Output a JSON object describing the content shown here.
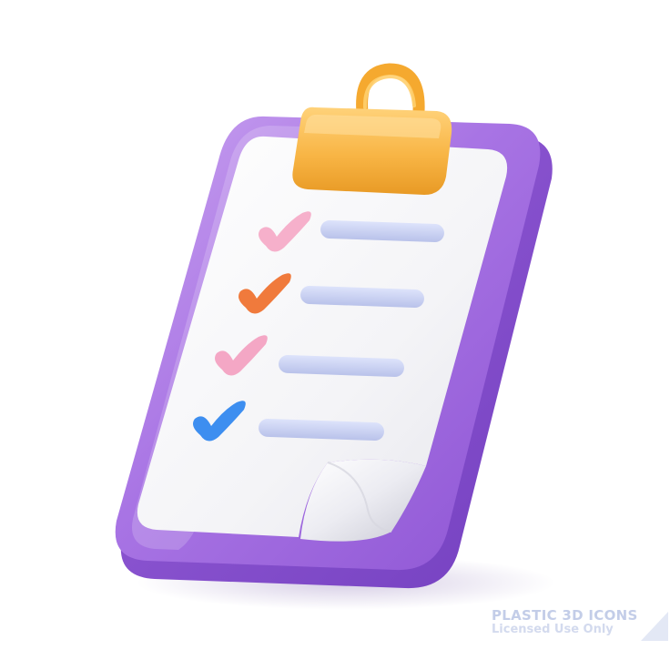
{
  "illustration": {
    "subject": "clipboard-checklist",
    "icon": "clipboard-checklist-icon",
    "checklist_items": [
      {
        "check_icon": "checkmark-icon",
        "check_color": "#f3a9c8",
        "line_color": "#cfd6f3"
      },
      {
        "check_icon": "checkmark-icon",
        "check_color": "#f07a3c",
        "line_color": "#cfd6f3"
      },
      {
        "check_icon": "checkmark-icon",
        "check_color": "#f4a0c2",
        "line_color": "#cfd6f3"
      },
      {
        "check_icon": "checkmark-icon",
        "check_color": "#3d8ef0",
        "line_color": "#cfd6f3"
      }
    ],
    "colors": {
      "board": "#a873e0",
      "board_shadow": "#8a54cf",
      "paper": "#f5f5f8",
      "clip": "#f7b540"
    }
  },
  "watermark": {
    "line1": "PLASTIC 3D ICONS",
    "line2": "Licensed Use Only"
  }
}
